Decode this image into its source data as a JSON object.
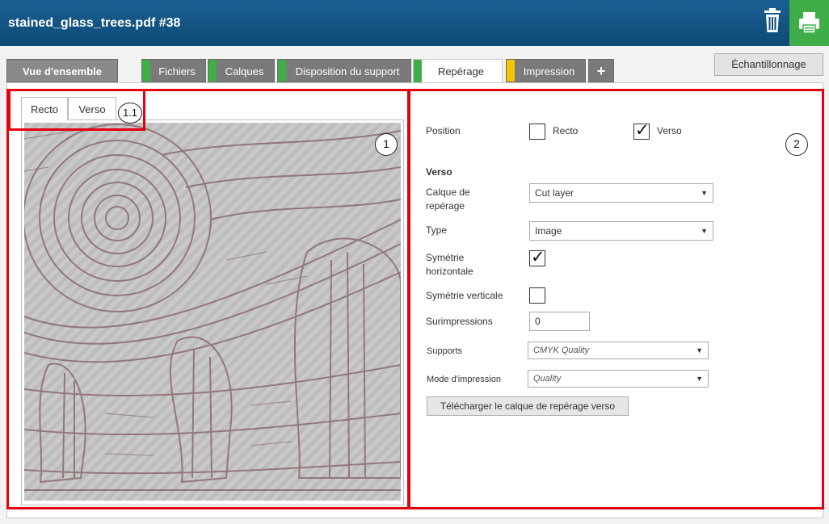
{
  "window": {
    "title": "stained_glass_trees.pdf #38"
  },
  "header": {
    "trash_icon": "trash-icon",
    "print_icon": "printer-icon",
    "print_bg": "#3fae49"
  },
  "tabs": [
    {
      "label": "Vue d'ensemble"
    },
    {
      "label": "Fichiers",
      "status_color": "#3fae49"
    },
    {
      "label": "Calques",
      "status_color": "#3fae49"
    },
    {
      "label": "Disposition du support",
      "status_color": "#3fae49"
    },
    {
      "label": "Repérage",
      "status_color": "#3fae49",
      "active": true
    },
    {
      "label": "Impression",
      "status_color": "#f5c400"
    },
    {
      "label": "+"
    }
  ],
  "sampling_button": "Échantillonnage",
  "preview": {
    "tabs": [
      "Recto",
      "Verso"
    ],
    "active_tab": "Recto"
  },
  "callouts": [
    "1",
    "1.1",
    "2"
  ],
  "form": {
    "position_label": "Position",
    "recto_label": "Recto",
    "recto_checked": false,
    "verso_label": "Verso",
    "verso_checked": true,
    "section_heading": "Verso",
    "calque_label": "Calque de repérage",
    "calque_value": "Cut layer",
    "type_label": "Type",
    "type_value": "Image",
    "sym_h_label": "Symétrie horizontale",
    "sym_h_checked": true,
    "sym_v_label": "Symétrie verticale",
    "sym_v_checked": false,
    "surimp_label": "Surimpressions",
    "surimp_value": "0",
    "supports_label": "Supports",
    "supports_value": "CMYK Quality",
    "mode_label": "Mode d'impression",
    "mode_value": "Quality",
    "download_button": "Télécharger le calque de repérage verso"
  },
  "colors": {
    "accent": "#0e4a76",
    "highlight": "#e3000f",
    "ok": "#3fae49",
    "warn": "#f5c400"
  }
}
